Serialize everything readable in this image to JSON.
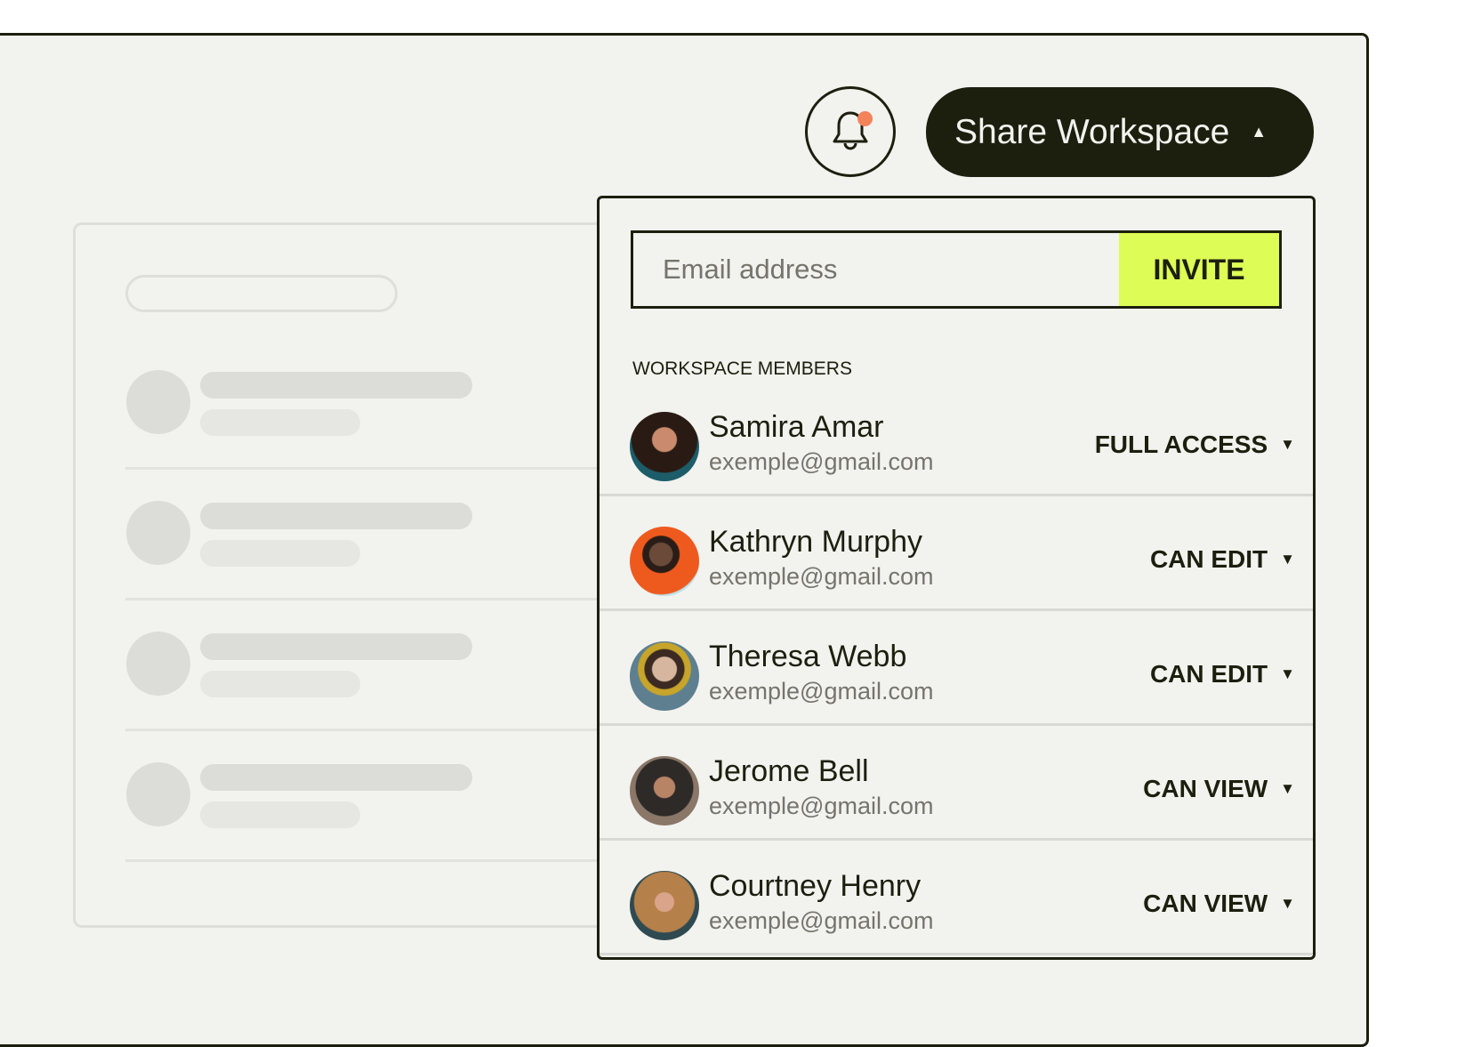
{
  "header": {
    "share_label": "Share Workspace",
    "share_caret": "▲",
    "bell_icon": "bell-icon",
    "notification_color": "#f4825a"
  },
  "invite": {
    "email_placeholder": "Email address",
    "email_value": "",
    "invite_label": "INVITE",
    "accent": "#ddfc55"
  },
  "members": {
    "label": "WORKSPACE MEMBERS",
    "items": [
      {
        "name": "Samira Amar",
        "email": "exemple@gmail.com",
        "role": "FULL ACCESS",
        "caret": "▼"
      },
      {
        "name": "Kathryn Murphy",
        "email": "exemple@gmail.com",
        "role": "CAN EDIT",
        "caret": "▼"
      },
      {
        "name": "Theresa Webb",
        "email": "exemple@gmail.com",
        "role": "CAN EDIT",
        "caret": "▼"
      },
      {
        "name": "Jerome Bell",
        "email": "exemple@gmail.com",
        "role": "CAN VIEW",
        "caret": "▼"
      },
      {
        "name": "Courtney Henry",
        "email": "exemple@gmail.com",
        "role": "CAN VIEW",
        "caret": "▼"
      }
    ]
  }
}
